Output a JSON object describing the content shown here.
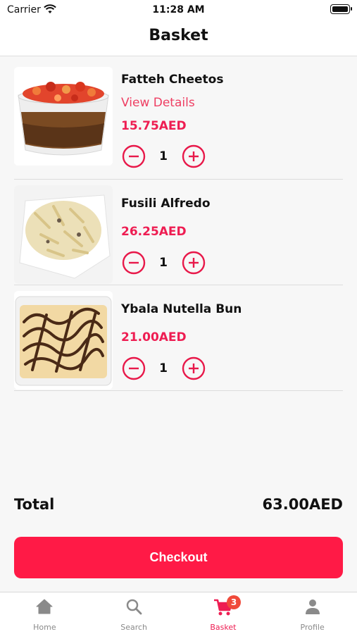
{
  "status_bar": {
    "carrier": "Carrier",
    "time": "11:28 AM"
  },
  "header": {
    "title": "Basket"
  },
  "items": [
    {
      "name": "Fatteh Cheetos",
      "details_link": "View Details",
      "price": "15.75AED",
      "quantity": "1"
    },
    {
      "name": "Fusili Alfredo",
      "price": "26.25AED",
      "quantity": "1"
    },
    {
      "name": "Ybala Nutella Bun",
      "price": "21.00AED",
      "quantity": "1"
    }
  ],
  "summary": {
    "total_label": "Total",
    "total_value": "63.00AED"
  },
  "checkout": {
    "label": "Checkout"
  },
  "tab_bar": {
    "tabs": [
      {
        "label": "Home",
        "icon": "home-icon"
      },
      {
        "label": "Search",
        "icon": "search-icon"
      },
      {
        "label": "Basket",
        "icon": "cart-icon",
        "active": true
      },
      {
        "label": "Profile",
        "icon": "person-icon"
      }
    ],
    "basket_badge": "3"
  },
  "colors": {
    "accent": "#ee1d52",
    "checkout_button": "#ff1a46",
    "badge": "#f04a3a"
  }
}
